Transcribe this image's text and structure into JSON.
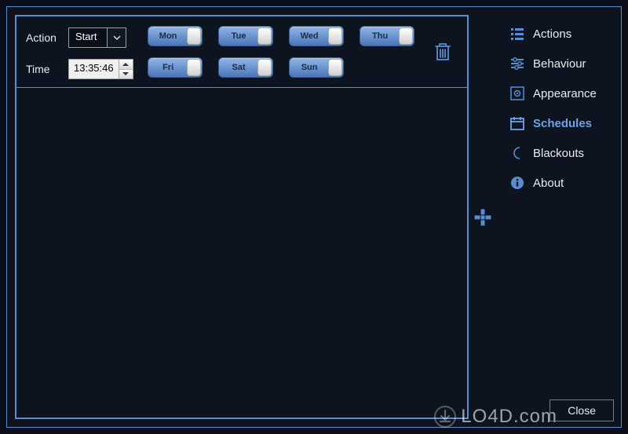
{
  "sidebar": {
    "items": [
      {
        "label": "Actions",
        "active": false
      },
      {
        "label": "Behaviour",
        "active": false
      },
      {
        "label": "Appearance",
        "active": false
      },
      {
        "label": "Schedules",
        "active": true
      },
      {
        "label": "Blackouts",
        "active": false
      },
      {
        "label": "About",
        "active": false
      }
    ]
  },
  "schedule": {
    "action_label": "Action",
    "action_value": "Start",
    "time_label": "Time",
    "time_value": "13:35:46",
    "days_row1": [
      "Mon",
      "Tue",
      "Wed",
      "Thu"
    ],
    "days_row2": [
      "Fri",
      "Sat",
      "Sun"
    ]
  },
  "footer": {
    "close_label": "Close"
  },
  "watermark": "LO4D.com",
  "colors": {
    "accent": "#5a8dd0",
    "toggle": "#6a95d8"
  }
}
